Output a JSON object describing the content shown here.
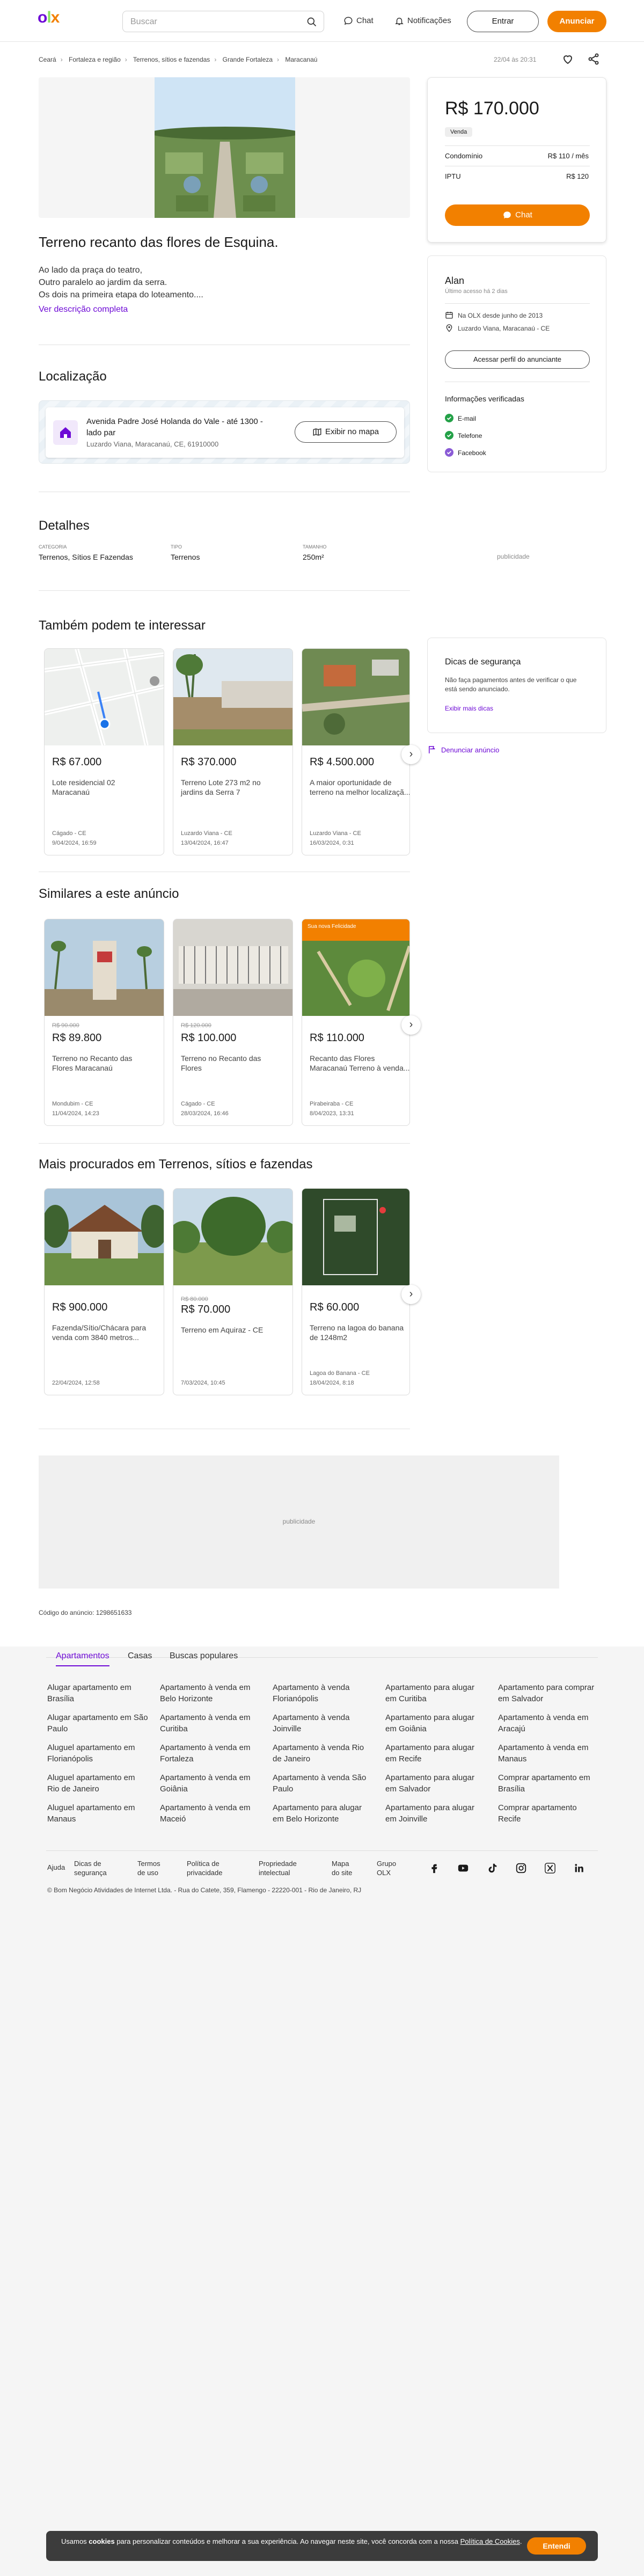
{
  "header": {
    "search_placeholder": "Buscar",
    "chat": "Chat",
    "notifications": "Notificações",
    "login": "Entrar",
    "post": "Anunciar"
  },
  "breadcrumb": [
    "Ceará",
    "Fortaleza e região",
    "Terrenos, sítios e fazendas",
    "Grande Fortaleza",
    "Maracanaú"
  ],
  "published": "22/04 às 20:31",
  "listing": {
    "title": "Terreno recanto das flores de Esquina.",
    "description": [
      "Ao lado da praça do teatro,",
      "Outro paralelo ao jardim da serra.",
      "Os dois na primeira etapa do loteamento...."
    ],
    "more": "Ver descrição completa"
  },
  "location": {
    "heading": "Localização",
    "address_line1": "Avenida Padre José Holanda do Vale - até 1300 -",
    "address_line2": "lado par",
    "city": "Luzardo Viana, Maracanaú, CE, 61910000",
    "map_button": "Exibir no mapa"
  },
  "details": {
    "heading": "Detalhes",
    "fields": [
      {
        "label": "CATEGORIA",
        "value": "Terrenos, Sítios E Fazendas"
      },
      {
        "label": "TIPO",
        "value": "Terrenos"
      },
      {
        "label": "TAMANHO",
        "value": "250m²"
      }
    ],
    "ad_label": "publicidade"
  },
  "price": {
    "value": "R$ 170.000",
    "badge": "Venda",
    "rows": [
      {
        "label": "Condomínio",
        "value": "R$ 110 / mês"
      },
      {
        "label": "IPTU",
        "value": "R$ 120"
      }
    ],
    "chat": "Chat"
  },
  "seller": {
    "name": "Alan",
    "last_seen": "Último acesso há 2 dias",
    "since": "Na OLX desde junho de 2013",
    "location": "Luzardo Viana, Maracanaú - CE",
    "profile_button": "Acessar perfil do anunciante",
    "verified_heading": "Informações verificadas",
    "verified": [
      "E-mail",
      "Telefone",
      "Facebook"
    ]
  },
  "safety": {
    "heading": "Dicas de segurança",
    "text": "Não faça pagamentos antes de verificar o que está sendo anunciado.",
    "more": "Exibir mais dicas",
    "report": "Denunciar anúncio"
  },
  "section1": {
    "heading": "Também podem te interessar",
    "ads": [
      {
        "price": "R$ 67.000",
        "old": "",
        "title": "Lote residencial 02 Maracanaú",
        "loc": "Cágado - CE",
        "date": "9/04/2024, 16:59"
      },
      {
        "price": "R$ 370.000",
        "old": "",
        "title": "Terreno Lote 273 m2 no jardins da Serra 7",
        "loc": "Luzardo Viana - CE",
        "date": "13/04/2024, 16:47"
      },
      {
        "price": "R$ 4.500.000",
        "old": "",
        "title": "A maior oportunidade de terreno na melhor localizaçã...",
        "loc": "Luzardo Viana - CE",
        "date": "16/03/2024, 0:31"
      }
    ]
  },
  "section2": {
    "heading": "Similares a este anúncio",
    "ads": [
      {
        "price": "R$ 89.800",
        "old": "R$ 90.000",
        "title": "Terreno no Recanto das Flores Maracanaú",
        "loc": "Mondubim - CE",
        "date": "11/04/2024, 14:23"
      },
      {
        "price": "R$ 100.000",
        "old": "R$ 120.000",
        "title": "Terreno no Recanto das Flores",
        "loc": "Cágado - CE",
        "date": "28/03/2024, 16:46"
      },
      {
        "price": "R$ 110.000",
        "old": "",
        "title": "Recanto das Flores Maracanaú Terreno à venda...",
        "loc": "Pirabeiraba - CE",
        "date": "8/04/2023, 13:31",
        "badge": "Sua nova Felicidade"
      }
    ]
  },
  "section3": {
    "heading": "Mais procurados em Terrenos, sítios e fazendas",
    "ads": [
      {
        "price": "R$ 900.000",
        "old": "",
        "title": "Fazenda/Sítio/Chácara para venda com 3840 metros...",
        "loc": "",
        "date": "22/04/2024, 12:58"
      },
      {
        "price": "R$ 70.000",
        "old": "R$ 80.000",
        "title": "Terreno em Aquiraz - CE",
        "loc": "",
        "date": "7/03/2024, 10:45"
      },
      {
        "price": "R$ 60.000",
        "old": "",
        "title": "Terreno na lagoa do banana de 1248m2",
        "loc": "Lagoa do Banana - CE",
        "date": "18/04/2024, 8:18"
      }
    ]
  },
  "ad_code": "Código do anúncio: 1298651633",
  "footer": {
    "tabs": [
      "Apartamentos",
      "Casas",
      "Buscas populares"
    ],
    "links": [
      [
        "Alugar apartamento em Brasília",
        "Alugar apartamento em São Paulo",
        "Aluguel apartamento em Florianópolis",
        "Aluguel apartamento em Rio de Janeiro",
        "Aluguel apartamento em Manaus"
      ],
      [
        "Apartamento à venda em Belo Horizonte",
        "Apartamento à venda em Curitiba",
        "Apartamento à venda em Fortaleza",
        "Apartamento à venda em Goiânia",
        "Apartamento à venda em Maceió"
      ],
      [
        "Apartamento à venda Florianópolis",
        "Apartamento à venda Joinville",
        "Apartamento à venda Rio de Janeiro",
        "Apartamento à venda São Paulo",
        "Apartamento para alugar em Belo Horizonte"
      ],
      [
        "Apartamento para alugar em Curitiba",
        "Apartamento para alugar em Goiânia",
        "Apartamento para alugar em Recife",
        "Apartamento para alugar em Salvador",
        "Apartamento para alugar em Joinville"
      ],
      [
        "Apartamento para comprar em Salvador",
        "Apartamento à venda em Aracajú",
        "Apartamento à venda em Manaus",
        "Comprar apartamento em Brasília",
        "Comprar apartamento Recife"
      ]
    ],
    "bottom_links": [
      "Ajuda",
      "Dicas de segurança",
      "Termos de uso",
      "Política de privacidade",
      "Propriedade intelectual",
      "Mapa do site",
      "Grupo OLX"
    ],
    "copyright": "© Bom Negócio Atividades de Internet Ltda. - Rua do Catete, 359, Flamengo - 22220-001 - Rio de Janeiro, RJ"
  },
  "cookie": {
    "text_pre": "Usamos ",
    "text_bold": "cookies",
    "text_mid": " para personalizar conteúdos e melhorar a sua experiência. Ao navegar neste site, você concorda com a nossa ",
    "policy": "Política de Cookies",
    "text_post": ".",
    "button": "Entendi"
  }
}
